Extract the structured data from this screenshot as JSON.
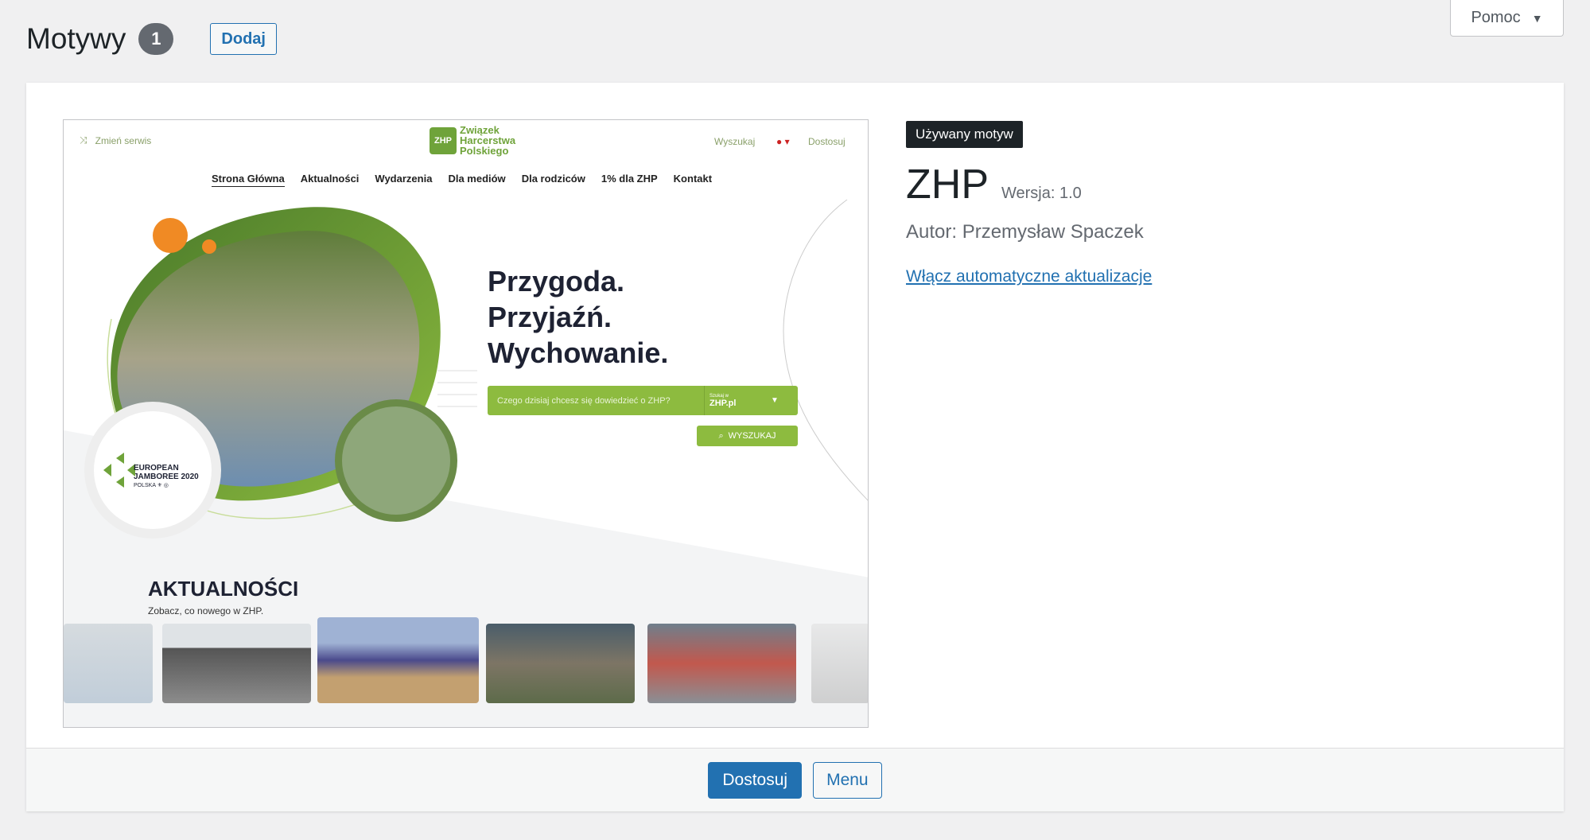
{
  "help_tab": {
    "label": "Pomoc"
  },
  "header": {
    "title": "Motywy",
    "count": "1",
    "add_label": "Dodaj"
  },
  "theme": {
    "current_label": "Używany motyw",
    "name": "ZHP",
    "version": "Wersja: 1.0",
    "author": "Autor: Przemysław Spaczek",
    "auto_update_link": "Włącz automatyczne aktualizacje",
    "actions": {
      "customize": "Dostosuj",
      "menu": "Menu"
    }
  },
  "preview": {
    "change_service": "Zmień serwis",
    "logo_text": [
      "Związek",
      "Harcerstwa",
      "Polskiego"
    ],
    "search": "Wyszukaj",
    "customize": "Dostosuj",
    "nav": [
      "Strona Główna",
      "Aktualności",
      "Wydarzenia",
      "Dla mediów",
      "Dla rodziców",
      "1% dla ZHP",
      "Kontakt"
    ],
    "slogan": [
      "Przygoda.",
      "Przyjaźń.",
      "Wychowanie."
    ],
    "search_placeholder": "Czego dzisiaj chcesz się dowiedzieć o ZHP?",
    "search_scope_small": "Szukaj w",
    "search_scope": "ZHP.pl",
    "search_button": "WYSZUKAJ",
    "jamboree": [
      "EUROPEAN",
      "JAMBOREE 2020",
      "POLSKA ⚜ ◎"
    ],
    "news_title": "AKTUALNOŚCI",
    "news_sub": "Zobacz, co nowego w ZHP."
  },
  "colors": {
    "accent": "#2271b1",
    "brand_green": "#8dbb3f",
    "orange": "#f08a24"
  }
}
